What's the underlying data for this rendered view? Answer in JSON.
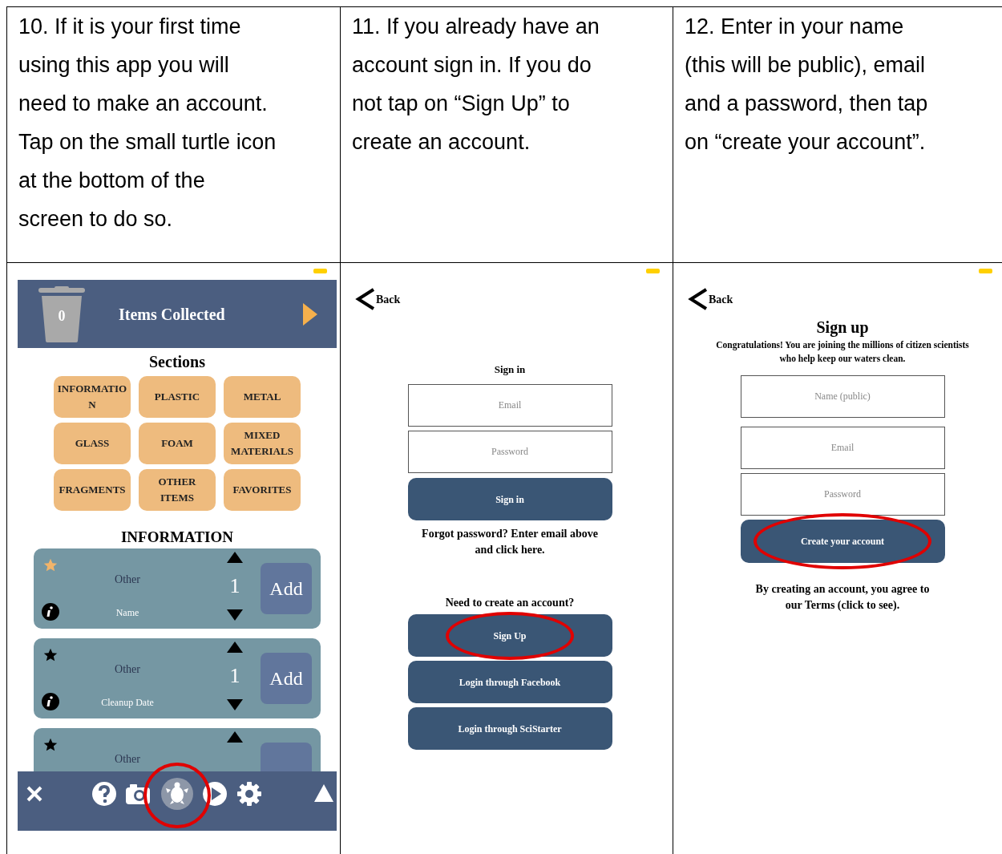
{
  "instructions": [
    {
      "lines": [
        "10. If it is your first time",
        "using this app you will",
        "need to make an account.",
        "Tap on the small turtle icon",
        "at the bottom of the",
        "screen to do so."
      ]
    },
    {
      "lines": [
        "11. If you already have an",
        "account sign in. If you do",
        "not tap on “Sign Up” to",
        "create an account."
      ]
    },
    {
      "lines": [
        "12. Enter in your name",
        "(this will be public), email",
        "and a password, then tap",
        "on “create your account”."
      ]
    }
  ],
  "collection_screen": {
    "count": "0",
    "title": "Items Collected",
    "sections_heading": "Sections",
    "sections": [
      "INFORMATION",
      "PLASTIC",
      "METAL",
      "GLASS",
      "FOAM",
      "MIXED MATERIALS",
      "FRAGMENTS",
      "OTHER ITEMS",
      "FAVORITES"
    ],
    "list_heading": "INFORMATION",
    "items": [
      {
        "favorite": true,
        "category": "Other",
        "name": "Name",
        "quantity": "1",
        "add_label": "Add"
      },
      {
        "favorite": false,
        "category": "Other",
        "name": "Cleanup Date",
        "quantity": "1",
        "add_label": "Add"
      },
      {
        "favorite": false,
        "category": "Other"
      }
    ],
    "toolbar": {
      "turtle_circled": true
    }
  },
  "signin_screen": {
    "back": "Back",
    "heading": "Sign in",
    "fields": [
      {
        "placeholder": "Email"
      },
      {
        "placeholder": "Password"
      }
    ],
    "submit": "Sign in",
    "forgot": "Forgot password? Enter email above and click here.",
    "create_prompt": "Need to create an account?",
    "buttons": [
      {
        "label": "Sign Up",
        "circled": true
      },
      {
        "label": "Login through Facebook",
        "circled": false
      },
      {
        "label": "Login through SciStarter",
        "circled": false
      }
    ]
  },
  "signup_screen": {
    "back": "Back",
    "title": "Sign up",
    "intro": "Congratulations! You are joining the millions of citizen scientists who help keep our waters clean.",
    "fields": [
      {
        "placeholder": "Name (public)"
      },
      {
        "placeholder": "Email"
      },
      {
        "placeholder": "Password"
      }
    ],
    "submit": {
      "label": "Create your account",
      "circled": true
    },
    "terms": "By creating an account, you agree to our Terms (click to see)."
  }
}
